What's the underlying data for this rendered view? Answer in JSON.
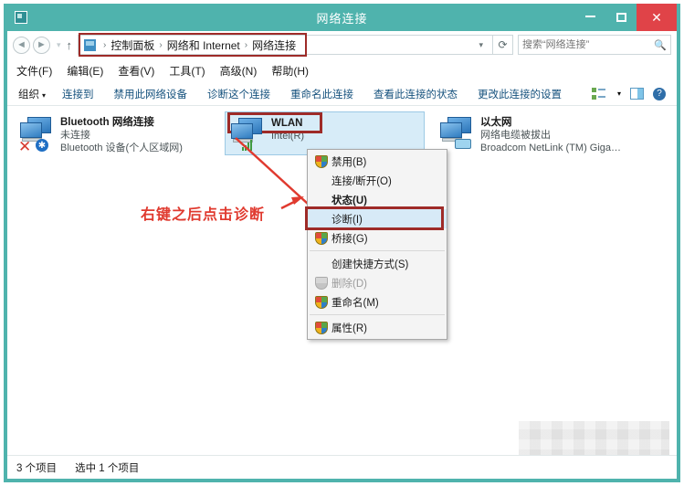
{
  "window": {
    "title": "网络连接",
    "icon": "network-folder-icon",
    "controls": {
      "minimize": "–",
      "maximize": "❐",
      "close": "✕"
    },
    "accent_color": "#4fb3ad",
    "close_color": "#e04348"
  },
  "addressbar": {
    "back": "◄",
    "forward": "►",
    "history_caret": "▾",
    "up": "↑",
    "crumbs": [
      "控制面板",
      "网络和 Internet",
      "网络连接"
    ],
    "separator": "›",
    "dropdown": "▾",
    "refresh": "⟳",
    "search": {
      "placeholder": "搜索“网络连接”",
      "value": "",
      "icon": "search-icon"
    }
  },
  "menubar": {
    "items": [
      {
        "label": "文件(F)"
      },
      {
        "label": "编辑(E)"
      },
      {
        "label": "查看(V)"
      },
      {
        "label": "工具(T)"
      },
      {
        "label": "高级(N)"
      },
      {
        "label": "帮助(H)"
      }
    ]
  },
  "toolbar": {
    "organize": "组织",
    "organize_caret": "▾",
    "items": [
      {
        "label": "连接到"
      },
      {
        "label": "禁用此网络设备"
      },
      {
        "label": "诊断这个连接"
      },
      {
        "label": "重命名此连接"
      },
      {
        "label": "查看此连接的状态"
      },
      {
        "label": "更改此连接的设置"
      }
    ],
    "view_caret": "▾",
    "help_glyph": "?"
  },
  "adapters": [
    {
      "name": "Bluetooth 网络连接",
      "status": "未连接",
      "device": "Bluetooth 设备(个人区域网)",
      "badge": "disconnected-x",
      "selected": false
    },
    {
      "name": "WLAN",
      "status": "",
      "device": "Intel(R)",
      "badge": "wifi-signal",
      "selected": true
    },
    {
      "name": "以太网",
      "status": "网络电缆被拔出",
      "device": "Broadcom NetLink (TM) Giga…",
      "badge": "cable-unplugged",
      "selected": false
    }
  ],
  "context_menu": {
    "items": [
      {
        "label": "禁用(B)",
        "shield": true,
        "bold": false,
        "disabled": false,
        "highlighted": false
      },
      {
        "label": "连接/断开(O)",
        "shield": false,
        "bold": false,
        "disabled": false,
        "highlighted": false
      },
      {
        "label": "状态(U)",
        "shield": false,
        "bold": true,
        "disabled": false,
        "highlighted": false
      },
      {
        "label": "诊断(I)",
        "shield": false,
        "bold": false,
        "disabled": false,
        "highlighted": true
      },
      {
        "label": "桥接(G)",
        "shield": true,
        "bold": false,
        "disabled": false,
        "highlighted": false
      },
      {
        "label": "创建快捷方式(S)",
        "shield": false,
        "bold": false,
        "disabled": false,
        "highlighted": false
      },
      {
        "label": "删除(D)",
        "shield": true,
        "bold": false,
        "disabled": true,
        "highlighted": false
      },
      {
        "label": "重命名(M)",
        "shield": true,
        "bold": false,
        "disabled": false,
        "highlighted": false
      },
      {
        "label": "属性(R)",
        "shield": true,
        "bold": false,
        "disabled": false,
        "highlighted": false
      }
    ]
  },
  "annotation": {
    "text": "右键之后点击诊断",
    "color": "#e03a2f",
    "highlight_color": "#9e2b28"
  },
  "statusbar": {
    "item_count": "3 个项目",
    "selection": "选中 1 个项目"
  }
}
